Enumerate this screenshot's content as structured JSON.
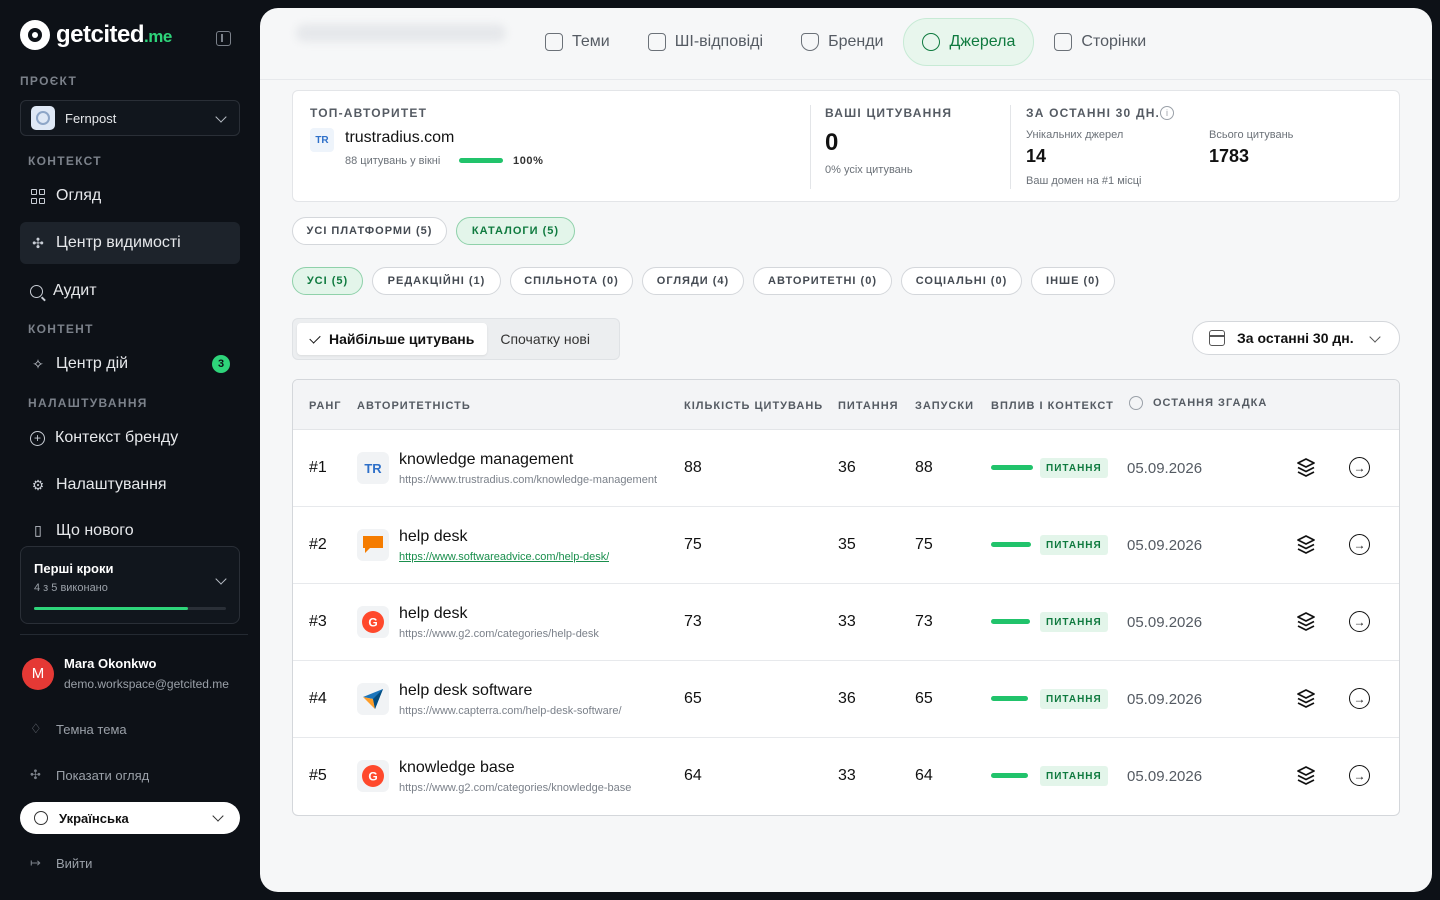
{
  "sidebar": {
    "logo_text": "getcited",
    "logo_suffix": ".me",
    "project_label": "ПРОЄКТ",
    "project_name": "Fernpost",
    "sections": {
      "context": "КОНТЕКСТ",
      "content": "КОНТЕНТ",
      "settings": "НАЛАШТУВАННЯ"
    },
    "items": {
      "overview": "Огляд",
      "visibility": "Центр видимості",
      "audit": "Аудит",
      "actions": "Центр дій",
      "actions_badge": "3",
      "brand_context": "Контекст бренду",
      "settings": "Налаштування",
      "whats_new": "Що нового"
    },
    "steps": {
      "title": "Перші кроки",
      "sub": "4 з 5 виконано",
      "done": 4,
      "total": 5
    },
    "user": {
      "initial": "M",
      "name": "Mara Okonkwo",
      "email": "demo.workspace@getcited.me"
    },
    "theme_link": "Темна тема",
    "tour_link": "Показати огляд",
    "language": "Українська",
    "logout": "Вийти"
  },
  "tabs": [
    {
      "label": "Теми"
    },
    {
      "label": "ШІ-відповіді"
    },
    {
      "label": "Бренди"
    },
    {
      "label": "Джерела"
    },
    {
      "label": "Сторінки"
    }
  ],
  "stats": {
    "top_label": "ТОП-АВТОРИТЕТ",
    "top_logo": "TR",
    "top_domain": "trustradius.com",
    "top_sub": "88 цитувань у вікні",
    "top_pct": "100%",
    "yours_label": "ВАШІ ЦИТУВАННЯ",
    "yours_value": "0",
    "yours_sub": "0% усіх цитувань",
    "last30_label": "ЗА ОСТАННІ 30 ДН.",
    "unique_label": "Унікальних джерел",
    "unique_value": "14",
    "unique_sub": "Ваш домен на #1 місці",
    "total_label": "Всього цитувань",
    "total_value": "1783"
  },
  "platform_filters": [
    {
      "label": "УСІ ПЛАТФОРМИ (5)"
    },
    {
      "label": "КАТАЛОГИ (5)"
    }
  ],
  "type_filters": [
    {
      "label": "УСІ (5)"
    },
    {
      "label": "РЕДАКЦІЙНІ (1)"
    },
    {
      "label": "СПІЛЬНОТА (0)"
    },
    {
      "label": "ОГЛЯДИ (4)"
    },
    {
      "label": "АВТОРИТЕТНІ (0)"
    },
    {
      "label": "СОЦІАЛЬНІ (0)"
    },
    {
      "label": "ІНШЕ (0)"
    }
  ],
  "sort": {
    "most_cited": "Найбільше цитувань",
    "newest": "Спочатку нові"
  },
  "date_range": "За останні 30 дн.",
  "table": {
    "headers": {
      "rank": "РАНГ",
      "authority": "АВТОРИТЕТНІСТЬ",
      "citations": "КІЛЬКІСТЬ ЦИТУВАНЬ",
      "prompts": "ПИТАННЯ",
      "runs": "ЗАПУСКИ",
      "influence": "ВПЛИВ І КОНТЕКСТ",
      "last_mention": "ОСТАННЯ ЗГАДКА"
    },
    "rows": [
      {
        "rank": "#1",
        "title": "knowledge management",
        "url": "https://www.trustradius.com/knowledge-management",
        "citations": "88",
        "prompts": "36",
        "runs": "88",
        "influence": 1.0,
        "tag": "ПИТАННЯ",
        "date": "05.09.2026",
        "logo": "trustradius"
      },
      {
        "rank": "#2",
        "title": "help desk",
        "url": "https://www.softwareadvice.com/help-desk/",
        "citations": "75",
        "prompts": "35",
        "runs": "75",
        "influence": 0.95,
        "tag": "ПИТАННЯ",
        "date": "05.09.2026",
        "logo": "softwareadvice"
      },
      {
        "rank": "#3",
        "title": "help desk",
        "url": "https://www.g2.com/categories/help-desk",
        "citations": "73",
        "prompts": "33",
        "runs": "73",
        "influence": 0.93,
        "tag": "ПИТАННЯ",
        "date": "05.09.2026",
        "logo": "g2"
      },
      {
        "rank": "#4",
        "title": "help desk software",
        "url": "https://www.capterra.com/help-desk-software/",
        "citations": "65",
        "prompts": "36",
        "runs": "65",
        "influence": 0.88,
        "tag": "ПИТАННЯ",
        "date": "05.09.2026",
        "logo": "capterra"
      },
      {
        "rank": "#5",
        "title": "knowledge base",
        "url": "https://www.g2.com/categories/knowledge-base",
        "citations": "64",
        "prompts": "33",
        "runs": "64",
        "influence": 0.87,
        "tag": "ПИТАННЯ",
        "date": "05.09.2026",
        "logo": "g2"
      }
    ]
  }
}
